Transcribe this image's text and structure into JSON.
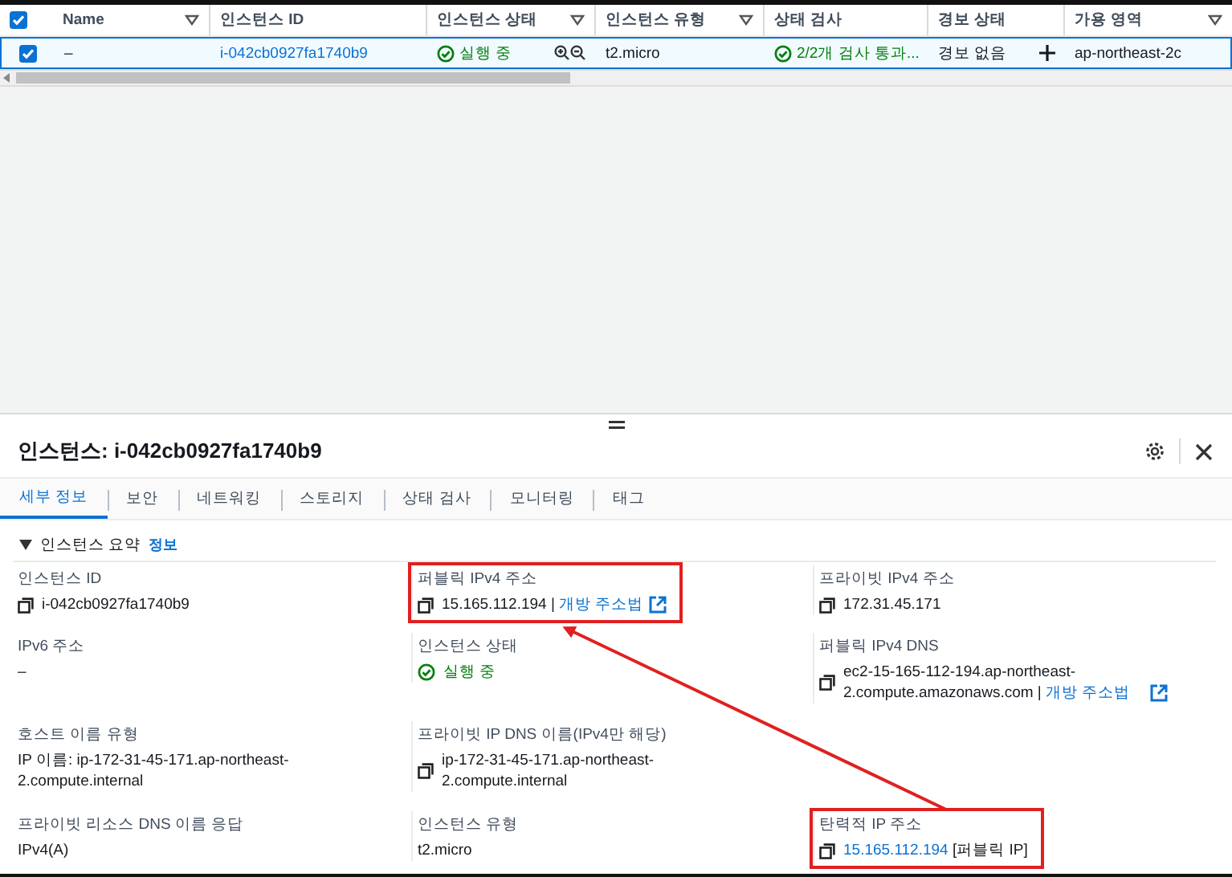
{
  "table": {
    "header_checked": true,
    "columns": [
      {
        "label": "Name",
        "filter": true
      },
      {
        "label": "인스턴스 ID",
        "filter": false
      },
      {
        "label": "인스턴스 상태",
        "filter": true
      },
      {
        "label": "인스턴스 유형",
        "filter": true
      },
      {
        "label": "상태 검사",
        "filter": false
      },
      {
        "label": "경보 상태",
        "filter": false
      },
      {
        "label": "가용 영역",
        "filter": true
      }
    ],
    "rows": [
      {
        "selected": true,
        "name": "–",
        "instance_id": "i-042cb0927fa1740b9",
        "state": "실행 중",
        "type": "t2.micro",
        "status_check": "2/2개 검사 통과...",
        "alarm": "경보 없음",
        "zone": "ap-northeast-2c"
      }
    ]
  },
  "panel": {
    "title": "인스턴스: i-042cb0927fa1740b9",
    "tabs": [
      {
        "label": "세부 정보",
        "selected": true
      },
      {
        "label": "보안",
        "selected": false
      },
      {
        "label": "네트워킹",
        "selected": false
      },
      {
        "label": "스토리지",
        "selected": false
      },
      {
        "label": "상태 검사",
        "selected": false
      },
      {
        "label": "모니터링",
        "selected": false
      },
      {
        "label": "태그",
        "selected": false
      }
    ],
    "section": {
      "title": "인스턴스 요약",
      "info_link": "정보",
      "expanded": true
    },
    "columns": [
      [
        {
          "label": "인스턴스 ID",
          "kind": "copy",
          "value": "i-042cb0927fa1740b9",
          "highlighted": false
        },
        {
          "label": "IPv6 주소",
          "kind": "text",
          "value": "–",
          "highlighted": false
        },
        {
          "label": "호스트 이름 유형",
          "kind": "text",
          "value": "IP 이름: ip-172-31-45-171.ap-northeast-2.compute.internal",
          "highlighted": false
        },
        {
          "label": "프라이빗 리소스 DNS 이름 응답",
          "kind": "text",
          "value": "IPv4(A)",
          "highlighted": false
        }
      ],
      [
        {
          "label": "퍼블릭 IPv4 주소",
          "kind": "copy",
          "value": "15.165.112.194",
          "separator": "|",
          "link": "개방 주소법",
          "highlighted": true
        },
        {
          "label": "인스턴스 상태",
          "kind": "status",
          "value": "실행 중",
          "highlighted": false
        },
        {
          "label": "프라이빗 IP DNS 이름(IPv4만 해당)",
          "kind": "copy",
          "value": "ip-172-31-45-171.ap-northeast-2.compute.internal",
          "highlighted": false
        },
        {
          "label": "인스턴스 유형",
          "kind": "text",
          "value": "t2.micro",
          "highlighted": false
        }
      ],
      [
        {
          "label": "프라이빗 IPv4 주소",
          "kind": "copy",
          "value": "172.31.45.171",
          "highlighted": false
        },
        {
          "label": "퍼블릭 IPv4 DNS",
          "kind": "copy",
          "value": "ec2-15-165-112-194.ap-northeast-2.compute.amazonaws.com",
          "separator": "|",
          "link": "개방 주소법",
          "highlighted": false
        },
        {
          "label": "탄력적 IP 주소",
          "kind": "copy_link",
          "value": "15.165.112.194",
          "suffix": "[퍼블릭 IP]",
          "highlighted": true
        }
      ]
    ],
    "annotation_arrow": true
  }
}
